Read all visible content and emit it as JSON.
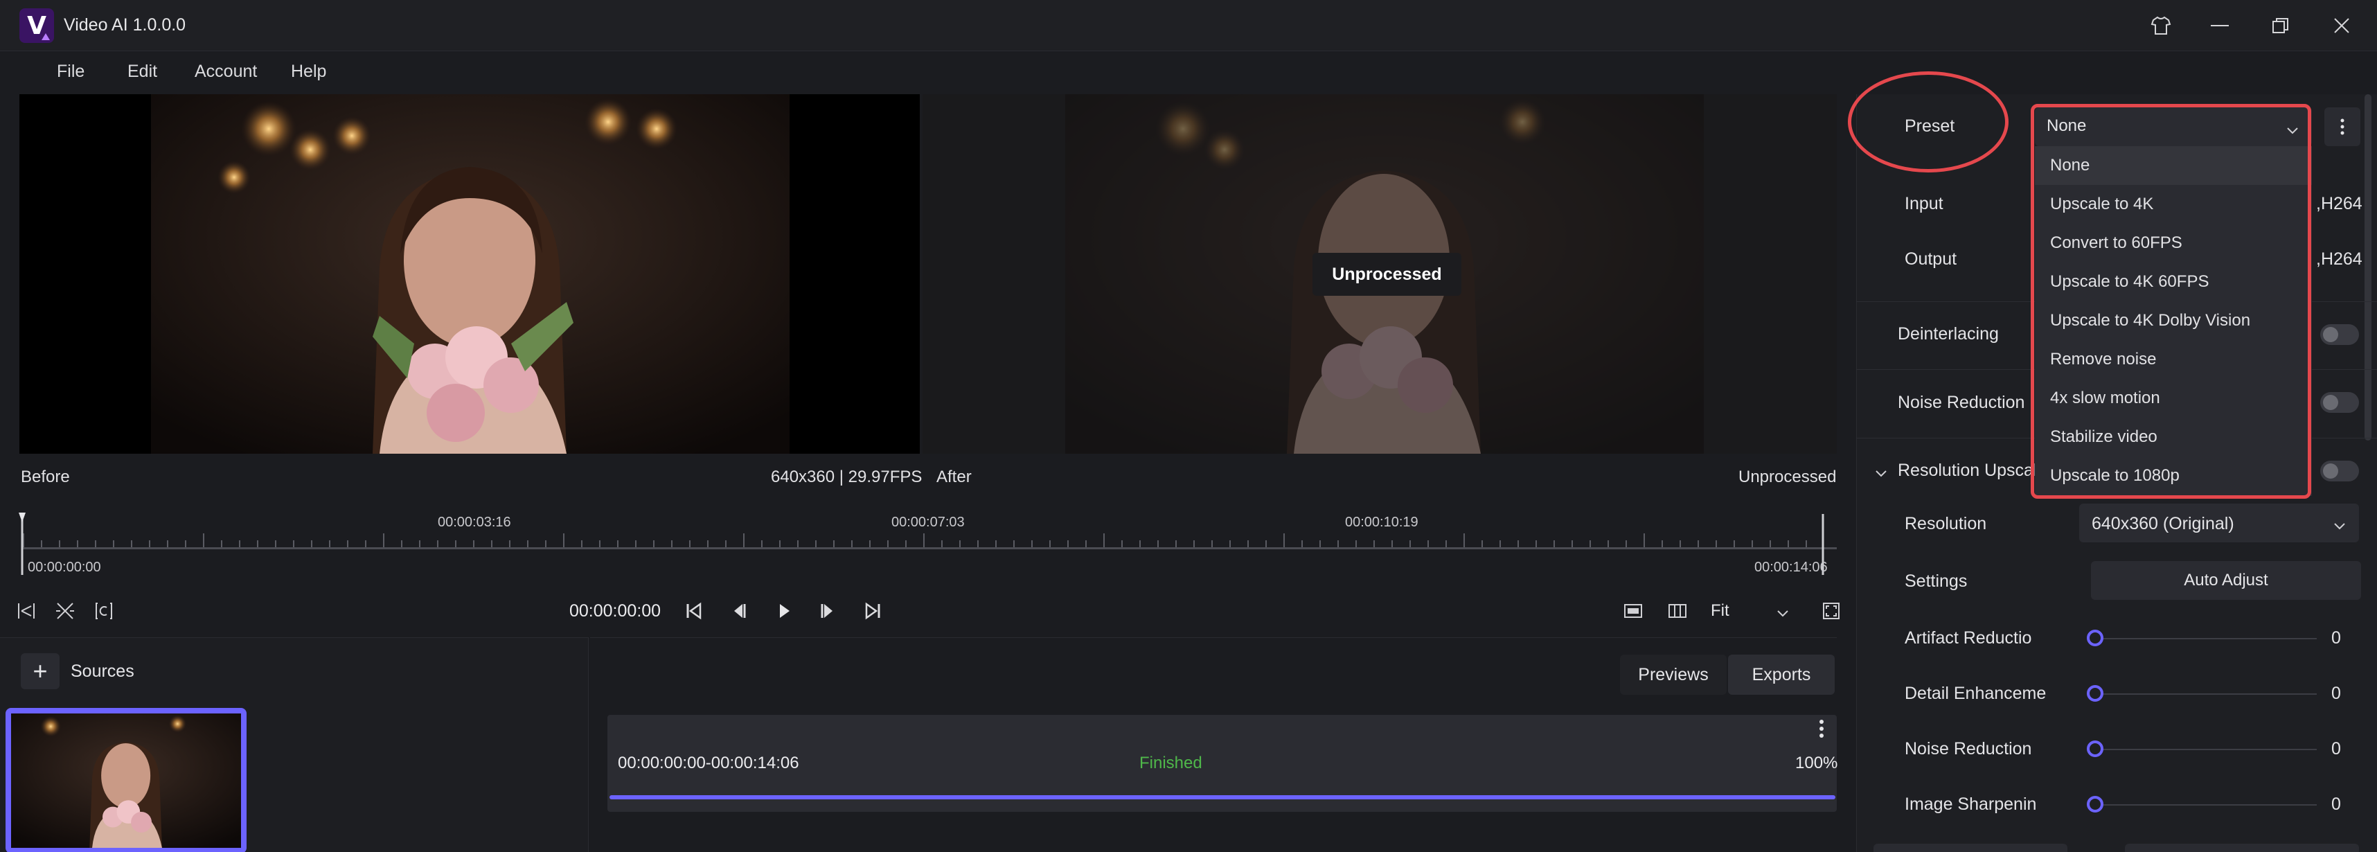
{
  "window": {
    "title": "Video AI 1.0.0.0",
    "logo_letter": "V"
  },
  "menu": [
    "File",
    "Edit",
    "Account",
    "Help"
  ],
  "preview": {
    "before_label": "Before",
    "info": "640x360 | 29.97FPS",
    "after_label": "After",
    "after_status": "Unprocessed",
    "badge": "Unprocessed"
  },
  "timeline": {
    "marks": [
      "00:00:03:16",
      "00:00:07:03",
      "00:00:10:19"
    ],
    "start": "00:00:00:00",
    "end": "00:00:14:06"
  },
  "transport": {
    "time": "00:00:00:00",
    "fit_label": "Fit"
  },
  "sources": {
    "label": "Sources",
    "add": "+"
  },
  "exports": {
    "tabs": [
      "Previews",
      "Exports"
    ],
    "item": {
      "range": "00:00:00:00-00:00:14:06",
      "status": "Finished",
      "percent": "100%",
      "progress": 1.0
    }
  },
  "settings": {
    "preset_label": "Preset",
    "preset_value": "None",
    "preset_options": [
      "None",
      "Upscale to 4K",
      "Convert to 60FPS",
      "Upscale to 4K 60FPS",
      "Upscale to 4K Dolby Vision",
      "Remove noise",
      "4x slow motion",
      "Stabilize video",
      "Upscale to 1080p"
    ],
    "input_label": "Input",
    "input_suffix": ",H264",
    "output_label": "Output",
    "output_suffix": ",H264",
    "deinterlacing_label": "Deinterlacing",
    "noise_reduction_label": "Noise Reduction",
    "resolution_upscale_label": "Resolution Upscal",
    "resolution_label": "Resolution",
    "resolution_value": "640x360 (Original)",
    "settings_label": "Settings",
    "auto_adjust_label": "Auto Adjust",
    "sliders": [
      {
        "label": "Artifact Reductio",
        "value": "0"
      },
      {
        "label": "Detail Enhanceme",
        "value": "0"
      },
      {
        "label": "Noise Reduction",
        "value": "0"
      },
      {
        "label": "Image Sharpenin",
        "value": "0"
      }
    ]
  },
  "colors": {
    "accent": "#6c63ff",
    "annotation": "#e5484d",
    "success": "#4fb84a"
  }
}
